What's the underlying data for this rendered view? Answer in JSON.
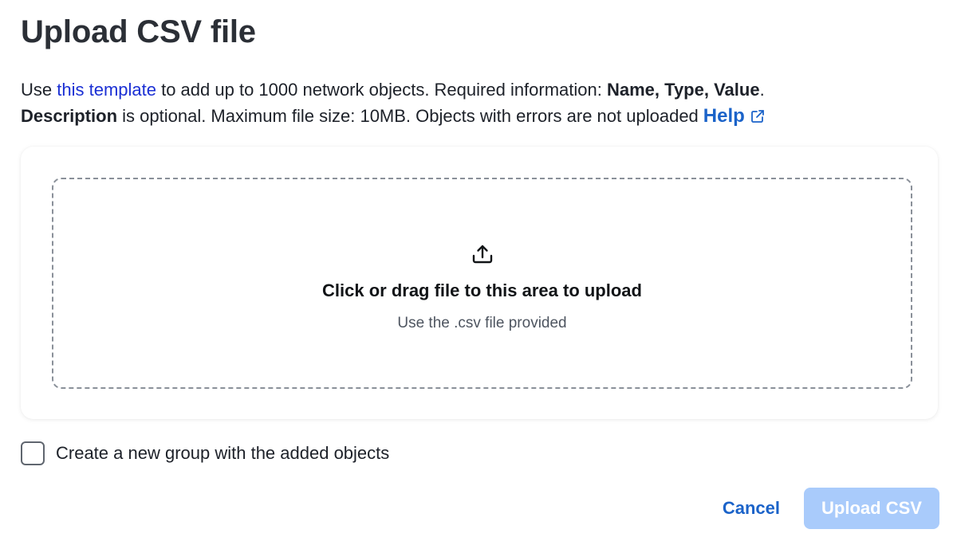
{
  "dialog": {
    "title": "Upload CSV file"
  },
  "description": {
    "prefix": "Use ",
    "template_link": "this template",
    "middle": " to add up to 1000 network objects. Required information: ",
    "required_fields": "Name, Type, Value",
    "after_required": ".",
    "optional_field": "Description",
    "rest": " is optional. Maximum file size: 10MB. Objects with errors are not uploaded",
    "help_link": "Help",
    "help_icon": "external-link-icon"
  },
  "dropzone": {
    "icon": "upload-icon",
    "main_text": "Click or drag file to this area to upload",
    "sub_text": "Use the .csv file provided"
  },
  "options": {
    "create_group_label": "Create a new group with the added objects",
    "create_group_checked": false
  },
  "footer": {
    "cancel_label": "Cancel",
    "upload_label": "Upload CSV",
    "upload_disabled": true
  },
  "colors": {
    "link": "#1a2fd4",
    "accent": "#1b63c9",
    "primary_disabled": "#a9cbfb",
    "dropzone_border": "#8a9099"
  }
}
